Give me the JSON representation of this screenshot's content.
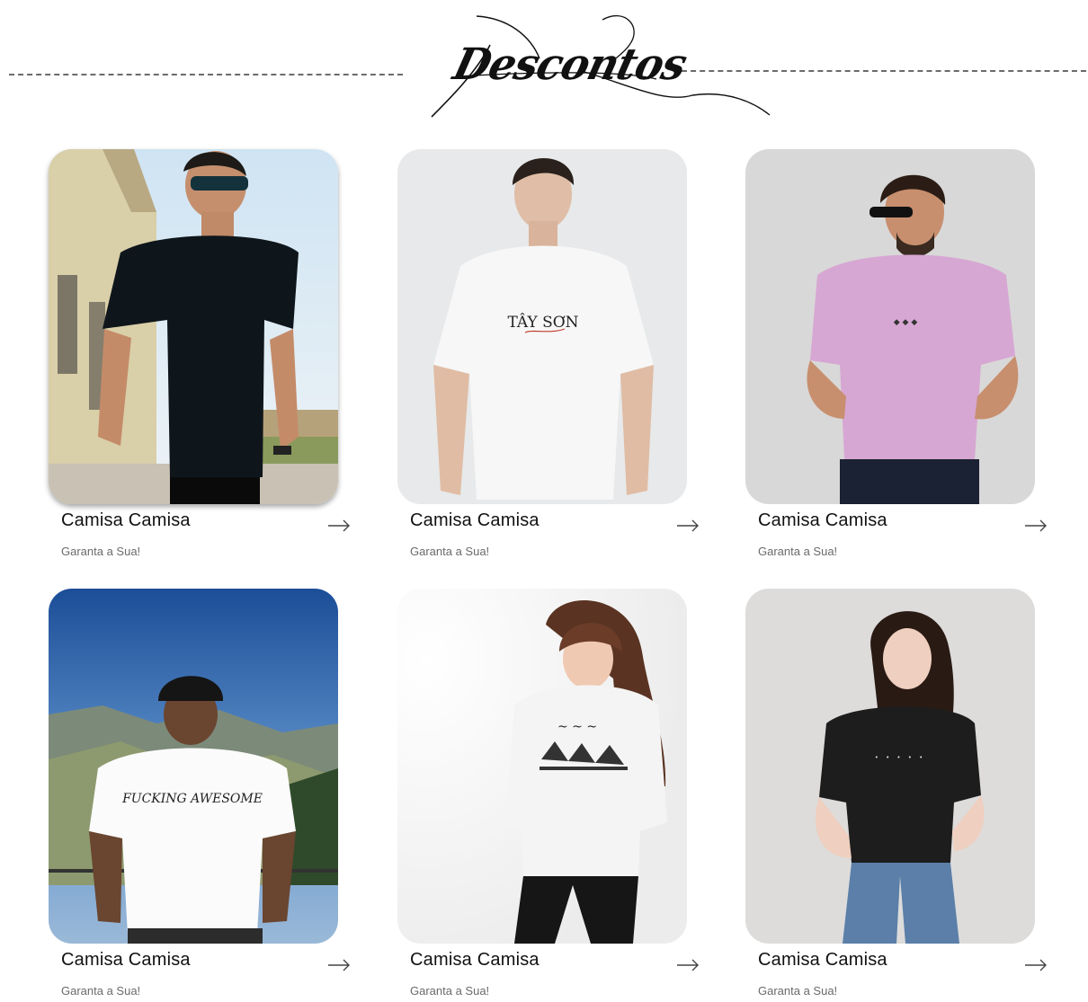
{
  "header": {
    "title": "Descontos"
  },
  "products": [
    {
      "name": "Camisa Camisa",
      "tagline": "Garanta a Sua!",
      "shirt_text": "",
      "photo": "man-black-tshirt-sunglasses-street"
    },
    {
      "name": "Camisa Camisa",
      "tagline": "Garanta a Sua!",
      "shirt_text": "TÂY SƠN",
      "photo": "man-white-tshirt-studio"
    },
    {
      "name": "Camisa Camisa",
      "tagline": "Garanta a Sua!",
      "shirt_text": "",
      "photo": "man-pink-tshirt-sunglasses"
    },
    {
      "name": "Camisa Camisa",
      "tagline": "Garanta a Sua!",
      "shirt_text": "FUCKING AWESOME",
      "photo": "man-white-tshirt-mountains"
    },
    {
      "name": "Camisa Camisa",
      "tagline": "Garanta a Sua!",
      "shirt_text": "",
      "photo": "woman-white-graphic-tshirt"
    },
    {
      "name": "Camisa Camisa",
      "tagline": "Garanta a Sua!",
      "shirt_text": "",
      "photo": "woman-black-tshirt-jeans"
    }
  ],
  "icons": {
    "arrow": "arrow-right-icon"
  },
  "colors": {
    "text": "#111111",
    "muted": "#6a6a6a",
    "dashes": "#6b6b6b"
  }
}
